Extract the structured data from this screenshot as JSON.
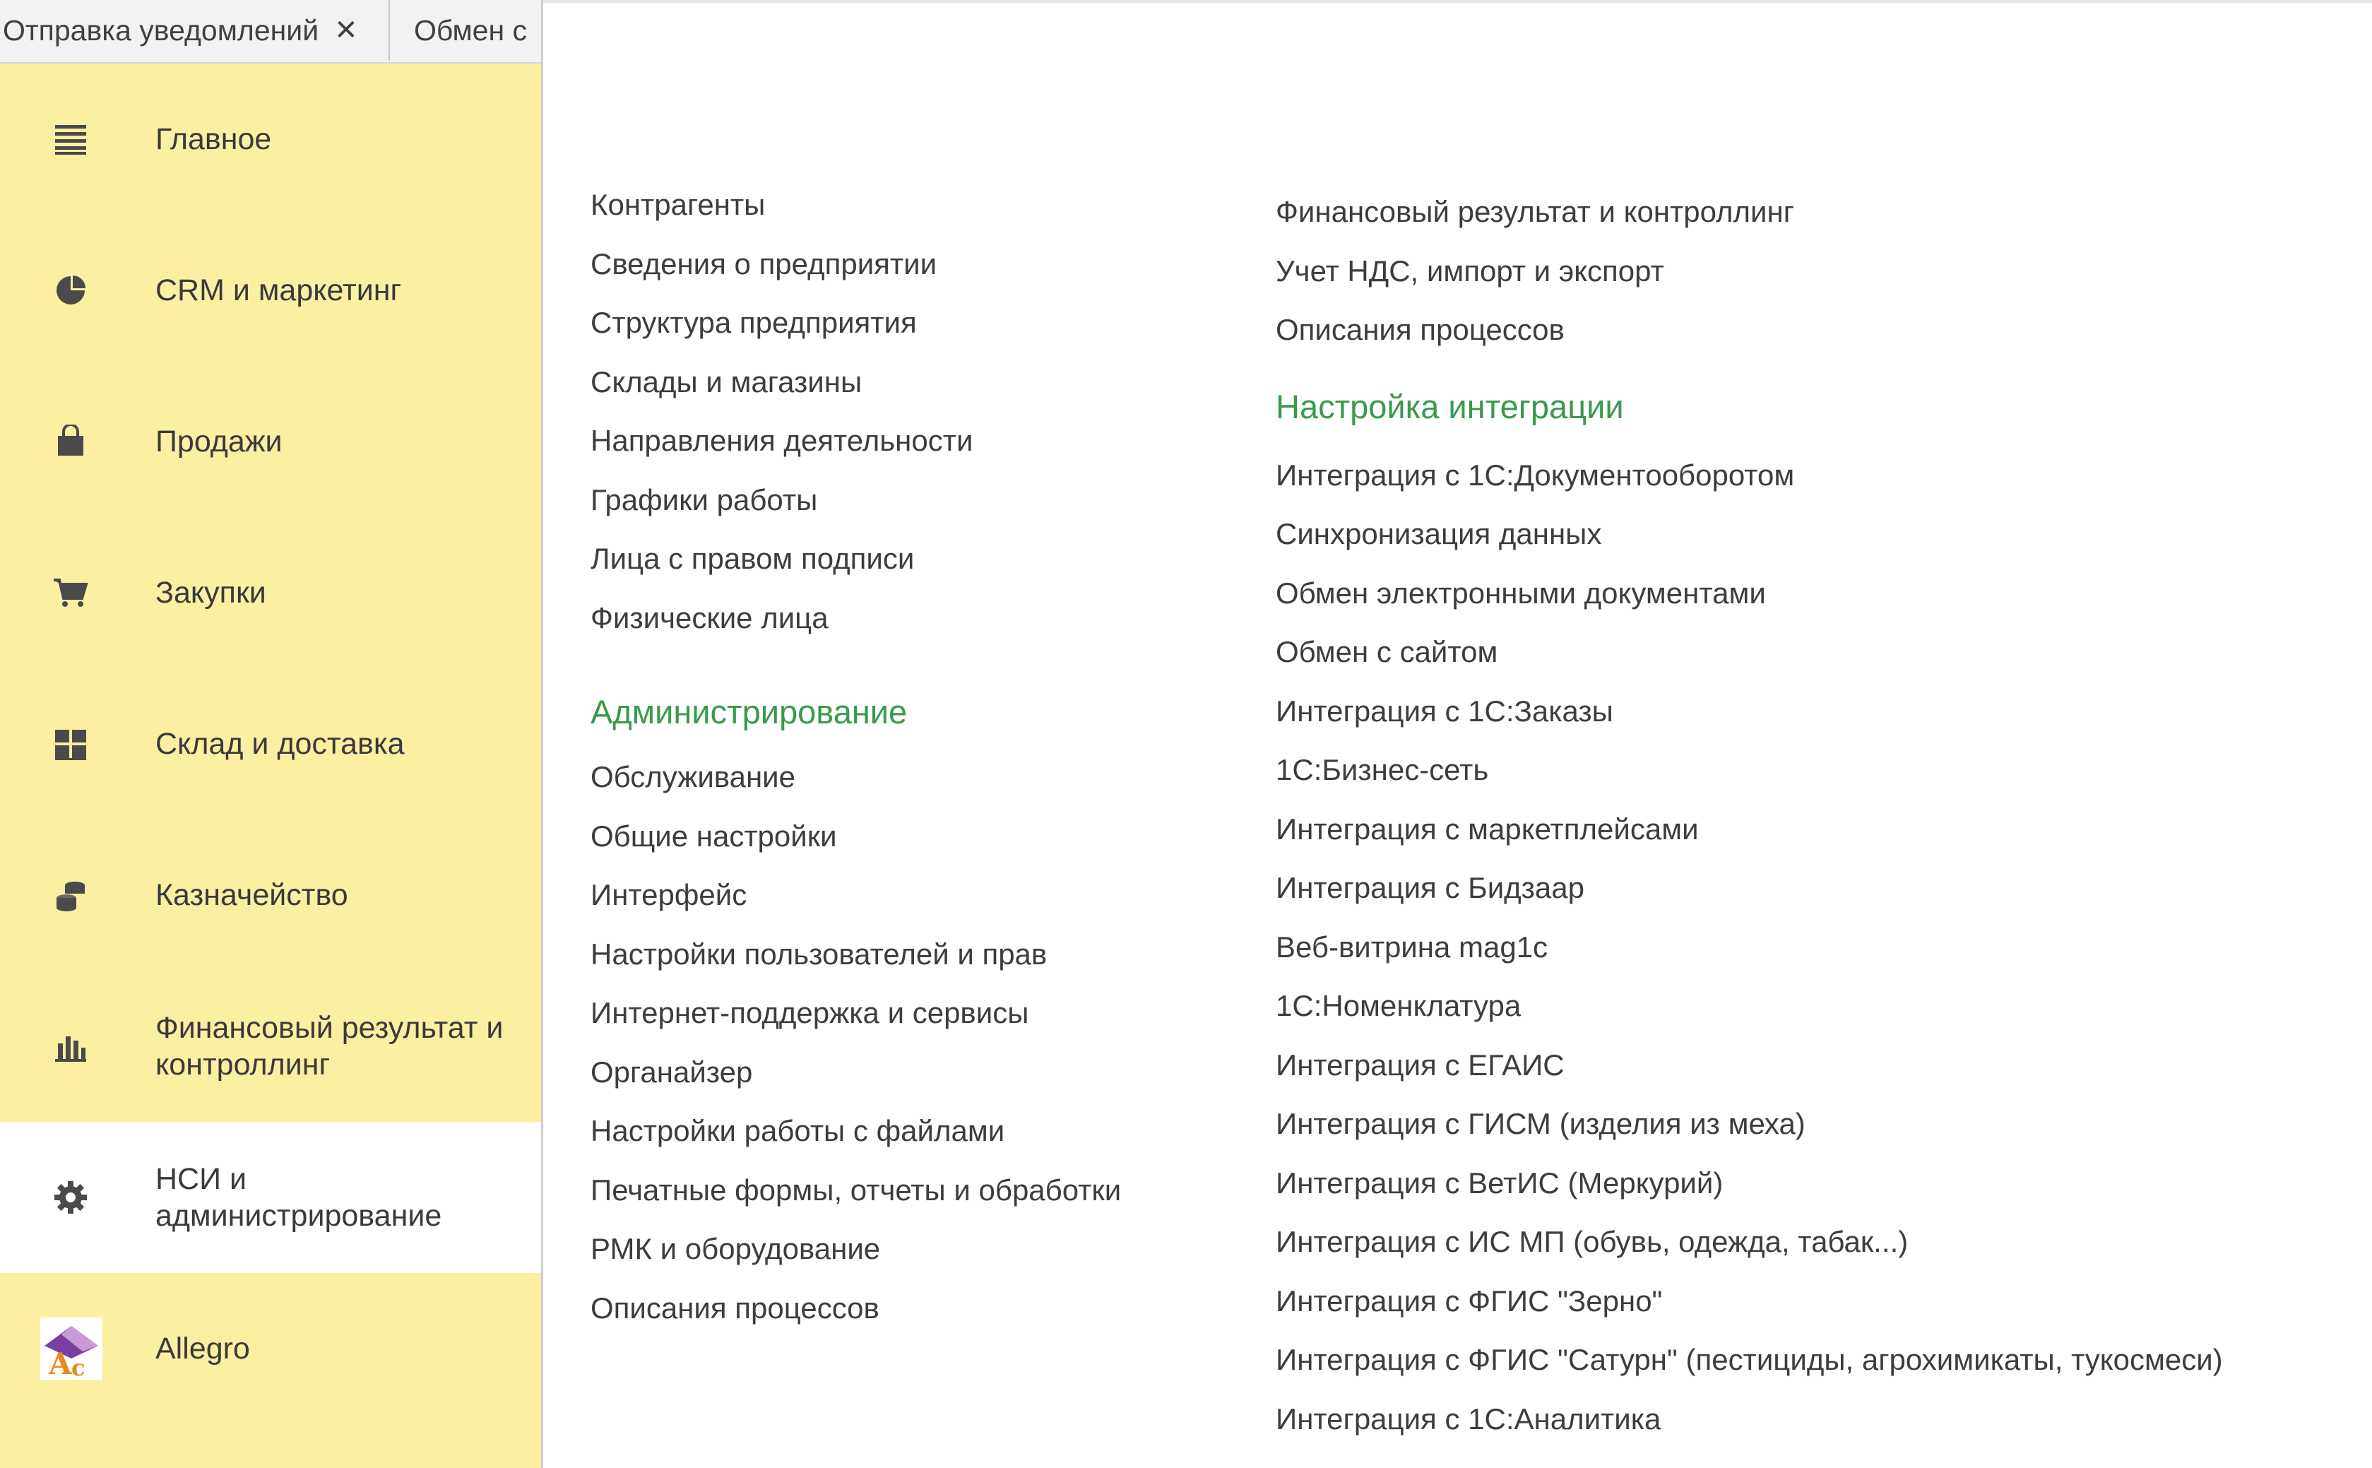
{
  "tabs": [
    {
      "label": "Отправка уведомлений",
      "closable": true
    },
    {
      "label": "Обмен с"
    }
  ],
  "sidebar": {
    "items": [
      {
        "label": "Главное",
        "icon": "menu-lines-icon"
      },
      {
        "label": "CRM и маркетинг",
        "icon": "pie-chart-icon"
      },
      {
        "label": "Продажи",
        "icon": "shopping-bag-icon"
      },
      {
        "label": "Закупки",
        "icon": "shopping-cart-icon"
      },
      {
        "label": "Склад и доставка",
        "icon": "warehouse-grid-icon"
      },
      {
        "label": "Казначейство",
        "icon": "coins-icon"
      },
      {
        "label": "Финансовый результат и контроллинг",
        "icon": "bar-chart-icon"
      },
      {
        "label": "НСИ и администрирование",
        "icon": "gear-icon",
        "active": true
      },
      {
        "label": "Allegro",
        "icon": "allegro-logo-icon"
      }
    ]
  },
  "colors": {
    "sidebar_bg": "#fbefa2",
    "section_title": "#3a9a4c",
    "active_item_bg": "#ffffff"
  },
  "main": {
    "left_column": {
      "links_top": [
        "Контрагенты",
        "Сведения о предприятии",
        "Структура предприятия",
        "Склады и магазины",
        "Направления деятельности",
        "Графики работы",
        "Лица с правом подписи",
        "Физические лица"
      ],
      "admin_section": {
        "title": "Администрирование",
        "links": [
          "Обслуживание",
          "Общие настройки",
          "Интерфейс",
          "Настройки пользователей и прав",
          "Интернет-поддержка и сервисы",
          "Органайзер",
          "Настройки работы с файлами",
          "Печатные формы, отчеты и обработки",
          "РМК и оборудование",
          "Описания процессов"
        ]
      }
    },
    "right_column": {
      "links_top": [
        "Финансовый результат и контроллинг",
        "Учет НДС, импорт и экспорт",
        "Описания процессов"
      ],
      "integration_section": {
        "title": "Настройка интеграции",
        "links": [
          "Интеграция с 1С:Документооборотом",
          "Синхронизация данных",
          "Обмен электронными документами",
          "Обмен с сайтом",
          "Интеграция с 1С:Заказы",
          "1С:Бизнес-сеть",
          "Интеграция с маркетплейсами",
          "Интеграция с Бидзаар",
          "Веб-витрина mag1c",
          "1С:Номенклатура",
          "Интеграция с ЕГАИС",
          "Интеграция с ГИСМ (изделия из меха)",
          "Интеграция с ВетИС (Меркурий)",
          "Интеграция с ИС МП (обувь, одежда, табак...)",
          "Интеграция с ФГИС \"Зерно\"",
          "Интеграция с ФГИС \"Сатурн\" (пестициды, агрохимикаты, тукосмеси)",
          "Интеграция с 1С:Аналитика"
        ]
      }
    }
  }
}
